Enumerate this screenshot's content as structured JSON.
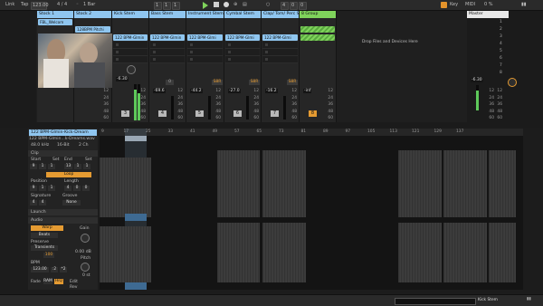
{
  "topbar": {
    "link": "Link",
    "tap": "Tap",
    "tempo": "123.00",
    "sig": "4 / 4",
    "quant": "1 Bar",
    "pos1": "1",
    "pos2": "1",
    "pos3": "1",
    "end1": "4",
    "end2": "0",
    "end3": "0",
    "key": "Key",
    "midi": "MIDI",
    "cpu": "0 %"
  },
  "tracks": [
    {
      "name": "Stock 1",
      "color": "#8fc6f0",
      "clips": [
        "FBL_Welcom",
        "",
        "",
        ""
      ],
      "vol": "",
      "pan": "",
      "num": "1",
      "val_a": "",
      "val_b": ""
    },
    {
      "name": "Stock 2",
      "color": "#8fc6f0",
      "clips": [
        "128BPM Pitchi",
        "",
        "",
        ""
      ],
      "vol": "",
      "pan": "",
      "num": "2",
      "val_a": "",
      "val_b": ""
    },
    {
      "name": "Kick Stem",
      "color": "#8fc6f0",
      "clips": [
        "122 BPM-Glmin",
        "",
        "",
        ""
      ],
      "vol": "-6.30",
      "pan": "C",
      "num": "3",
      "val_a": "",
      "val_b": ""
    },
    {
      "name": "Bass Stem",
      "color": "#8fc6f0",
      "clips": [
        "122 BPM-Glmin",
        "",
        "",
        ""
      ],
      "vol": "-69.6",
      "pan": "C",
      "num": "4",
      "val_a": "",
      "val_b": "0"
    },
    {
      "name": "Instrument Stem",
      "color": "#8fc6f0",
      "clips": [
        "122 BPM-Glmi",
        "",
        "",
        ""
      ],
      "vol": "-44.2",
      "pan": "C",
      "num": "5",
      "val_a": "",
      "val_b": "S8R"
    },
    {
      "name": "Cymbal Stem",
      "color": "#8fc6f0",
      "clips": [
        "122 BPM-Glmi",
        "",
        "",
        ""
      ],
      "vol": "-27.0",
      "pan": "C",
      "num": "6",
      "val_a": "",
      "val_b": "S8R"
    },
    {
      "name": "Clap/ Tom/ Perc S",
      "color": "#8fc6f0",
      "clips": [
        "122 BPM-Glmi",
        "",
        "",
        ""
      ],
      "vol": "-16.2",
      "pan": "C",
      "num": "7",
      "val_a": "",
      "val_b": "S8R"
    },
    {
      "name": "8 Group",
      "color": "#7fd35b",
      "clips": [
        "",
        "",
        "",
        ""
      ],
      "vol": "-inf",
      "pan": "C",
      "num": "8",
      "val_a": "",
      "val_b": ""
    }
  ],
  "session": {
    "drop_text": "Drop Files and Devices Here"
  },
  "master": {
    "name": "Master",
    "scenes": [
      "1",
      "2",
      "3",
      "4",
      "5",
      "6",
      "7",
      "8"
    ],
    "vol": "-6.30",
    "pan": "C"
  },
  "scale": [
    "12",
    "24",
    "36",
    "48",
    "60"
  ],
  "clipview": {
    "clip_name": "122 BPM-Glmin-Kick-Dream",
    "file_name": "122 BPM-Glmin...k-Dreams.wav",
    "sample_rate": "48.0 kHz",
    "bit_depth": "16-Bit",
    "channels": "2 Ch",
    "section_clip": "Clip",
    "start_label": "Start",
    "set_label": "Set",
    "end_label": "End",
    "start_val": "9",
    "start_val2": "1",
    "start_val3": "1",
    "end_val": "13",
    "end_val2": "1",
    "end_val3": "1",
    "loop_label": "Loop",
    "position_label": "Position",
    "length_label": "Length",
    "pos_val": "9",
    "pos_val2": "1",
    "pos_val3": "1",
    "len_val": "4",
    "len_val2": "0",
    "len_val3": "0",
    "signature_label": "Signature",
    "groove_label": "Groove",
    "sig_num": "4",
    "sig_den": "4",
    "groove_val": "None",
    "section_launch": "Launch",
    "section_audio": "Audio",
    "warp_label": "Warp",
    "beats_label": "Beats",
    "preserve_label": "Preserve",
    "transients_label": "Transients",
    "gain_label": "Gain",
    "gain_val": "0.00 dB",
    "pitch_label": "Pitch",
    "pitch_val": "0 st",
    "bpm_label": "BPM",
    "bpm_val": "123.00",
    "half": ":2",
    "double": "*2",
    "fade_label": "Fade",
    "ram_label": "RAM",
    "hiq_label": "HiQ",
    "edit_label": "Edit",
    "rev_label": "Rev",
    "inv_label": "Inv",
    "one_hundred": "100"
  },
  "ruler": [
    "9",
    "17",
    "25",
    "33",
    "41",
    "49",
    "57",
    "65",
    "73",
    "81",
    "89",
    "97",
    "105",
    "113",
    "121",
    "129",
    "137"
  ],
  "status": {
    "track": "Kick Stem"
  }
}
